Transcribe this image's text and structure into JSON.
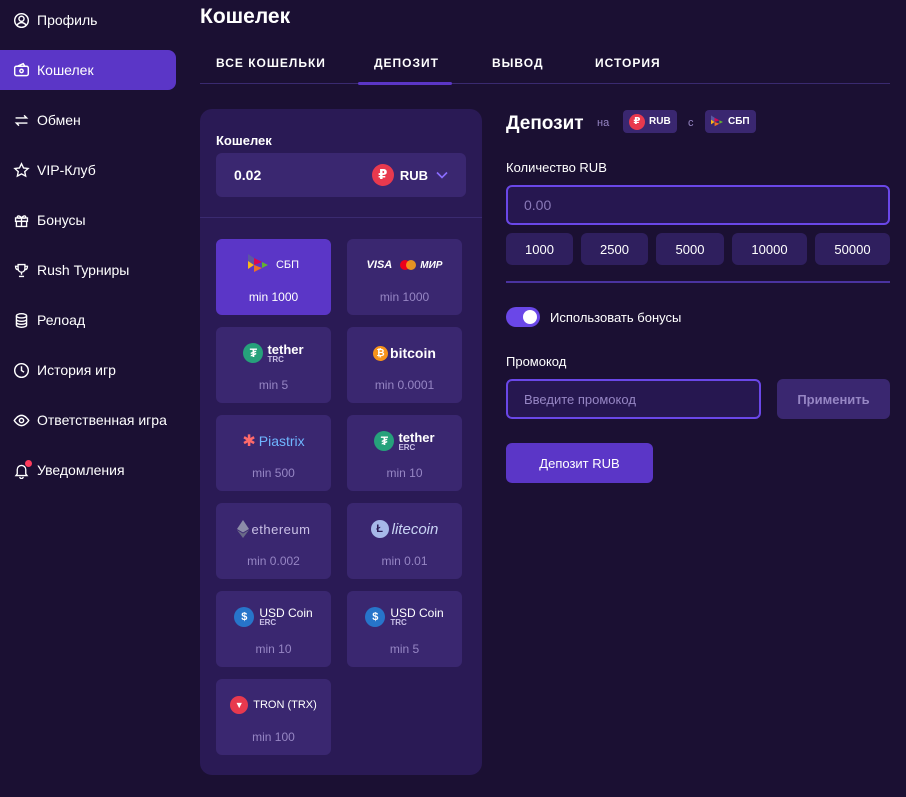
{
  "sidebar": {
    "items": [
      {
        "label": "Профиль",
        "icon": "user-circle-icon"
      },
      {
        "label": "Кошелек",
        "icon": "wallet-icon",
        "active": true
      },
      {
        "label": "Обмен",
        "icon": "exchange-icon"
      },
      {
        "label": "VIP-Клуб",
        "icon": "star-icon"
      },
      {
        "label": "Бонусы",
        "icon": "gift-icon"
      },
      {
        "label": "Rush Турниры",
        "icon": "trophy-icon"
      },
      {
        "label": "Релоад",
        "icon": "database-icon"
      },
      {
        "label": "История игр",
        "icon": "clock-icon"
      },
      {
        "label": "Ответственная игра",
        "icon": "eye-icon"
      },
      {
        "label": "Уведомления",
        "icon": "bell-icon"
      }
    ]
  },
  "header": {
    "title": "Кошелек",
    "tabs": [
      "ВСЕ КОШЕЛЬКИ",
      "ДЕПОЗИТ",
      "ВЫВОД",
      "ИСТОРИЯ"
    ],
    "active_tab": "ДЕПОЗИТ"
  },
  "wallet": {
    "label": "Кошелек",
    "amount": "0.02",
    "currency": "RUB",
    "currency_symbol": "₽"
  },
  "methods": [
    {
      "name": "СБП",
      "min": "min 1000",
      "active": true
    },
    {
      "name": "VISA",
      "name2": "МИР",
      "min": "min 1000"
    },
    {
      "name": "tether",
      "sub": "TRC",
      "min": "min 5"
    },
    {
      "name": "bitcoin",
      "min": "min 0.0001"
    },
    {
      "name": "Piastrix",
      "min": "min 500"
    },
    {
      "name": "tether",
      "sub": "ERC",
      "min": "min 10"
    },
    {
      "name": "ethereum",
      "min": "min 0.002"
    },
    {
      "name": "litecoin",
      "min": "min 0.01"
    },
    {
      "name": "USD Coin",
      "sub": "ERC",
      "min": "min 10"
    },
    {
      "name": "USD Coin",
      "sub": "TRC",
      "min": "min 5"
    },
    {
      "name": "TRON (TRX)",
      "min": "min 100"
    }
  ],
  "deposit": {
    "title": "Депозит",
    "on_label": "на",
    "from_label": "с",
    "currency_chip": "RUB",
    "method_chip": "СБП",
    "amount_label": "Количество RUB",
    "amount_placeholder": "0.00",
    "quick_amounts": [
      "1000",
      "2500",
      "5000",
      "10000",
      "50000"
    ],
    "use_bonus_label": "Использовать бонусы",
    "use_bonus": true,
    "promo_label": "Промокод",
    "promo_placeholder": "Введите промокод",
    "apply_label": "Применить",
    "submit_label": "Депозит RUB"
  },
  "colors": {
    "background": "#1b1033",
    "panel": "#2a1a55",
    "accent": "#5b36c7",
    "card": "#3a2770",
    "rub": "#e8394e"
  }
}
